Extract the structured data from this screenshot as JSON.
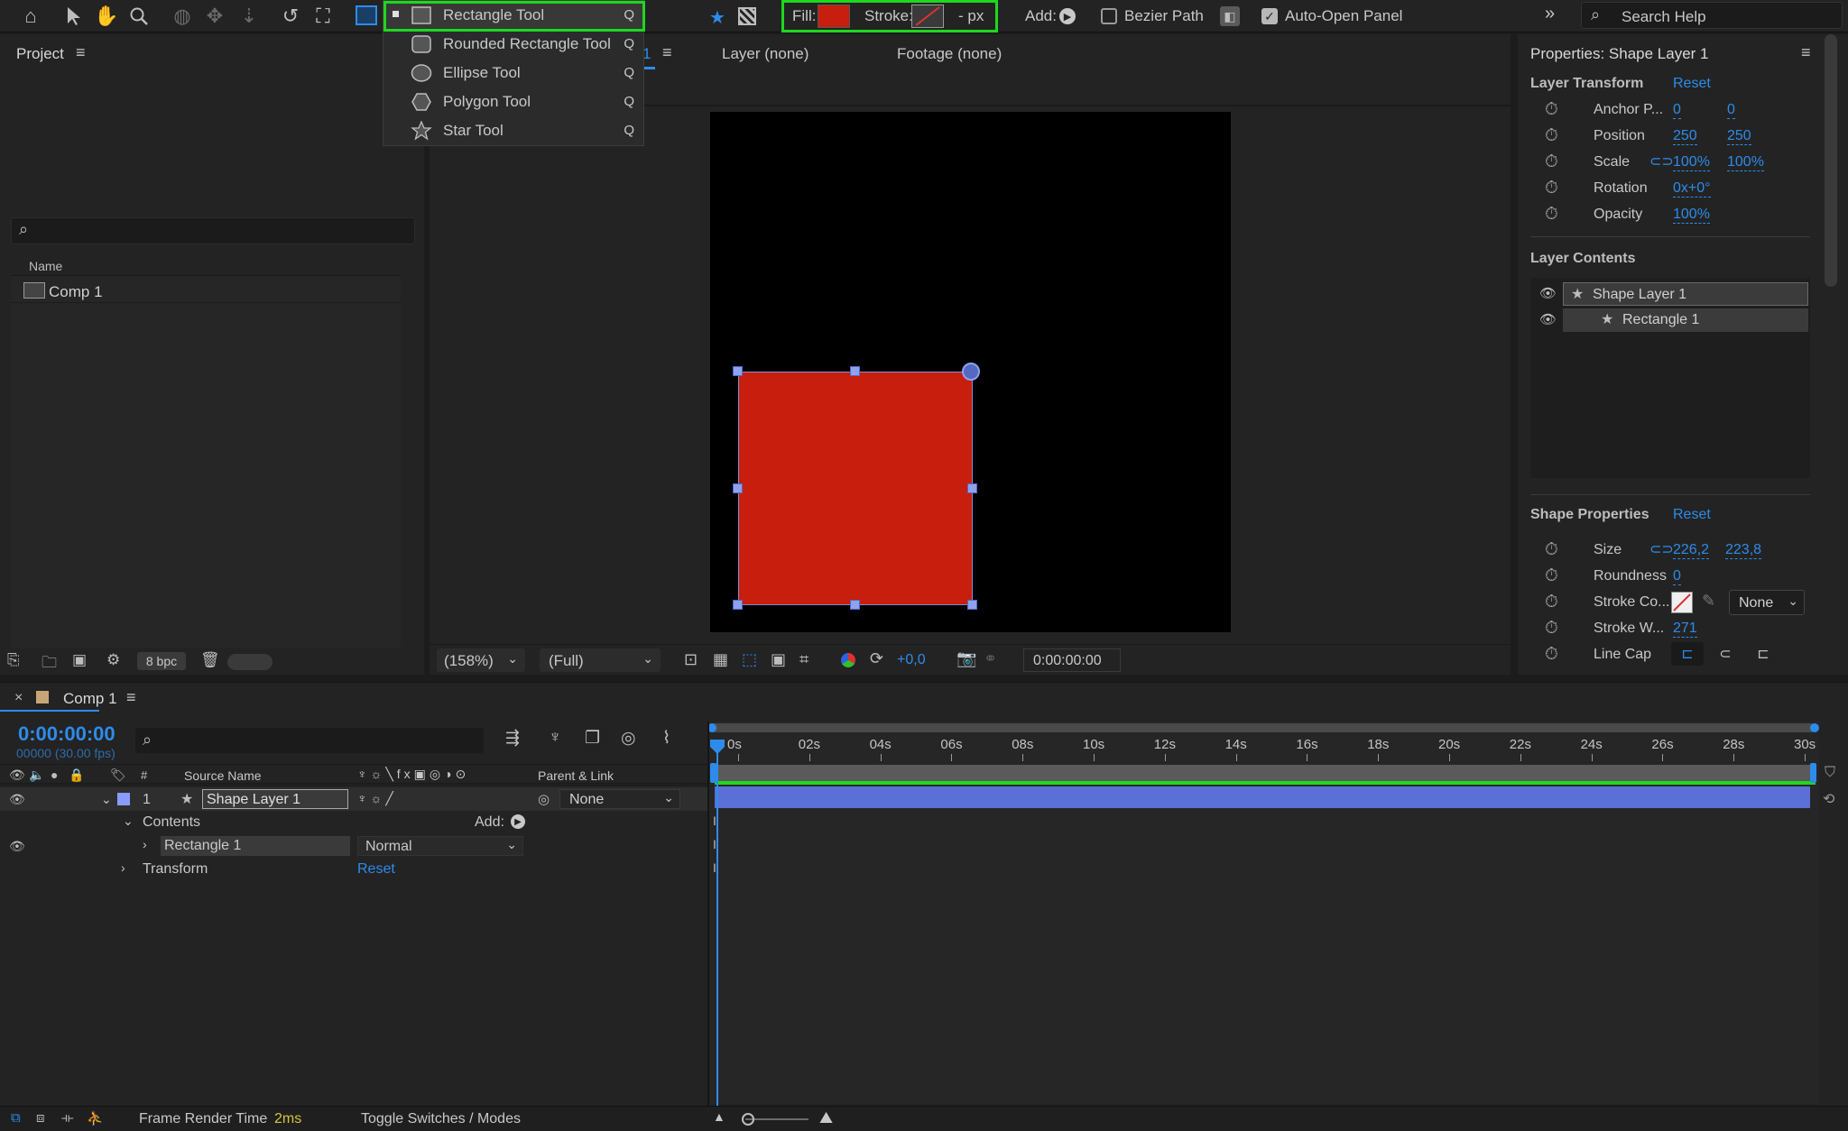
{
  "toolbar": {
    "fill_label": "Fill:",
    "stroke_label": "Stroke:",
    "stroke_width": "- px",
    "add_label": "Add:",
    "bezier_label": "Bezier Path",
    "autopanel_label": "Auto-Open Panel",
    "search_placeholder": "Search Help",
    "fill_color": "#c81e0e"
  },
  "tool_menu": {
    "items": [
      {
        "label": "Rectangle Tool",
        "key": "Q",
        "icon": "rectangle-icon",
        "selected": true
      },
      {
        "label": "Rounded Rectangle Tool",
        "key": "Q",
        "icon": "rounded-rectangle-icon"
      },
      {
        "label": "Ellipse Tool",
        "key": "Q",
        "icon": "ellipse-icon"
      },
      {
        "label": "Polygon Tool",
        "key": "Q",
        "icon": "polygon-icon"
      },
      {
        "label": "Star Tool",
        "key": "Q",
        "icon": "star-icon"
      }
    ]
  },
  "project": {
    "title": "Project",
    "column_name": "Name",
    "items": [
      {
        "name": "Comp 1"
      }
    ],
    "bpc": "8 bpc"
  },
  "viewer": {
    "tab_comp": "1",
    "tab_layer": "Layer (none)",
    "tab_footage": "Footage (none)",
    "zoom": "(158%)",
    "resolution": "(Full)",
    "exposure": "+0,0",
    "timecode": "0:00:00:00"
  },
  "properties": {
    "title": "Properties: Shape Layer 1",
    "layer_transform": "Layer Transform",
    "reset": "Reset",
    "transform_rows": [
      {
        "name": "Anchor P...",
        "v1": "0",
        "v2": "0"
      },
      {
        "name": "Position",
        "v1": "250",
        "v2": "250"
      },
      {
        "name": "Scale",
        "v1": "100%",
        "v2": "100%"
      },
      {
        "name": "Rotation",
        "v1": "0x+0°"
      },
      {
        "name": "Opacity",
        "v1": "100%"
      }
    ],
    "layer_contents": "Layer Contents",
    "contents": [
      {
        "name": "Shape Layer 1"
      },
      {
        "name": "Rectangle 1"
      }
    ],
    "shape_properties": "Shape Properties",
    "shape_rows": [
      {
        "name": "Size",
        "v1": "226,2",
        "v2": "223,8"
      },
      {
        "name": "Roundness",
        "v1": "0"
      },
      {
        "name": "Stroke Co...",
        "v1": "None"
      },
      {
        "name": "Stroke W...",
        "v1": "271"
      },
      {
        "name": "Line Cap"
      }
    ]
  },
  "timeline": {
    "comp_tab": "Comp 1",
    "timecode": "0:00:00:00",
    "frames": "00000 (30.00 fps)",
    "col_number": "#",
    "col_source": "Source Name",
    "col_parent": "Parent & Link",
    "layers": [
      {
        "number": "1",
        "name": "Shape Layer 1",
        "parent": "None"
      }
    ],
    "contents_label": "Contents",
    "add_label": "Add:",
    "rectangle_label": "Rectangle 1",
    "blend_mode": "Normal",
    "transform_label": "Transform",
    "reset": "Reset",
    "ruler": [
      "0s",
      "02s",
      "04s",
      "06s",
      "08s",
      "10s",
      "12s",
      "14s",
      "16s",
      "18s",
      "20s",
      "22s",
      "24s",
      "26s",
      "28s",
      "30s"
    ]
  },
  "status": {
    "frame_render_label": "Frame Render Time",
    "frame_render_value": "2ms",
    "toggle_label": "Toggle Switches / Modes"
  }
}
